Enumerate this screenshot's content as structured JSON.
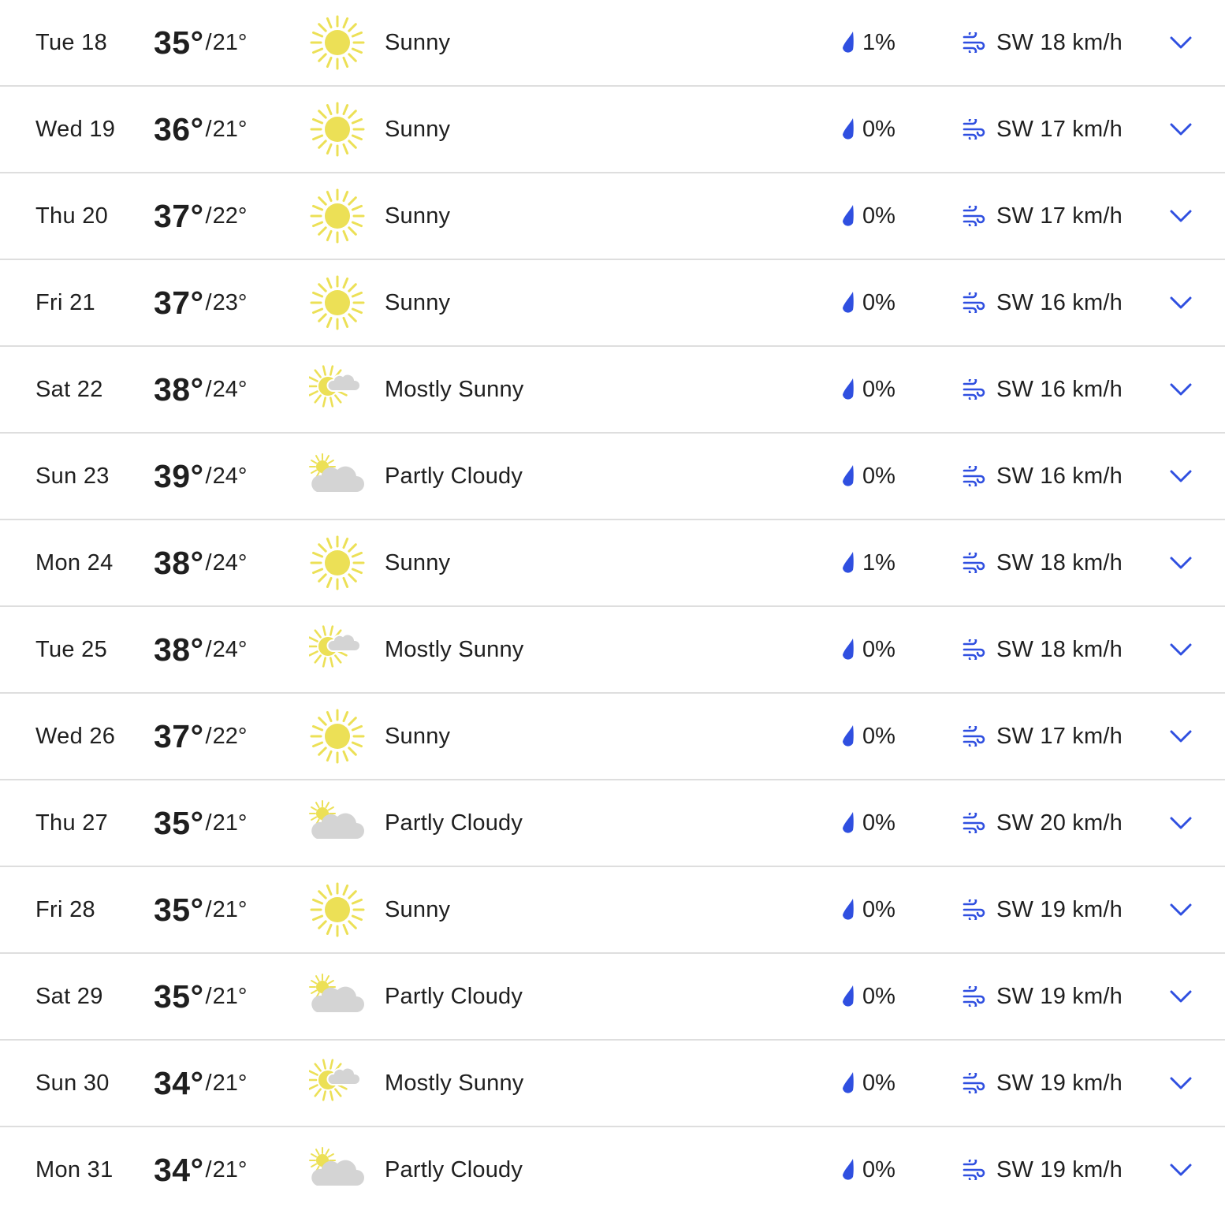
{
  "colors": {
    "text": "#1f1f1f",
    "accent": "#2f4fe0",
    "divider": "#dedede",
    "sun": "#ece056",
    "cloud": "#d4d4d4"
  },
  "forecast": [
    {
      "day": "Tue 18",
      "hi": "35°",
      "sep": "/",
      "lo": "21°",
      "icon": "sunny-icon",
      "condition": "Sunny",
      "precip": "1%",
      "wind": "SW 18 km/h"
    },
    {
      "day": "Wed 19",
      "hi": "36°",
      "sep": "/",
      "lo": "21°",
      "icon": "sunny-icon",
      "condition": "Sunny",
      "precip": "0%",
      "wind": "SW 17 km/h"
    },
    {
      "day": "Thu 20",
      "hi": "37°",
      "sep": "/",
      "lo": "22°",
      "icon": "sunny-icon",
      "condition": "Sunny",
      "precip": "0%",
      "wind": "SW 17 km/h"
    },
    {
      "day": "Fri 21",
      "hi": "37°",
      "sep": "/",
      "lo": "23°",
      "icon": "sunny-icon",
      "condition": "Sunny",
      "precip": "0%",
      "wind": "SW 16 km/h"
    },
    {
      "day": "Sat 22",
      "hi": "38°",
      "sep": "/",
      "lo": "24°",
      "icon": "mostly-sunny-icon",
      "condition": "Mostly Sunny",
      "precip": "0%",
      "wind": "SW 16 km/h"
    },
    {
      "day": "Sun 23",
      "hi": "39°",
      "sep": "/",
      "lo": "24°",
      "icon": "partly-cloudy-icon",
      "condition": "Partly Cloudy",
      "precip": "0%",
      "wind": "SW 16 km/h"
    },
    {
      "day": "Mon 24",
      "hi": "38°",
      "sep": "/",
      "lo": "24°",
      "icon": "sunny-icon",
      "condition": "Sunny",
      "precip": "1%",
      "wind": "SW 18 km/h"
    },
    {
      "day": "Tue 25",
      "hi": "38°",
      "sep": "/",
      "lo": "24°",
      "icon": "mostly-sunny-icon",
      "condition": "Mostly Sunny",
      "precip": "0%",
      "wind": "SW 18 km/h"
    },
    {
      "day": "Wed 26",
      "hi": "37°",
      "sep": "/",
      "lo": "22°",
      "icon": "sunny-icon",
      "condition": "Sunny",
      "precip": "0%",
      "wind": "SW 17 km/h"
    },
    {
      "day": "Thu 27",
      "hi": "35°",
      "sep": "/",
      "lo": "21°",
      "icon": "partly-cloudy-icon",
      "condition": "Partly Cloudy",
      "precip": "0%",
      "wind": "SW 20 km/h"
    },
    {
      "day": "Fri 28",
      "hi": "35°",
      "sep": "/",
      "lo": "21°",
      "icon": "sunny-icon",
      "condition": "Sunny",
      "precip": "0%",
      "wind": "SW 19 km/h"
    },
    {
      "day": "Sat 29",
      "hi": "35°",
      "sep": "/",
      "lo": "21°",
      "icon": "partly-cloudy-icon",
      "condition": "Partly Cloudy",
      "precip": "0%",
      "wind": "SW 19 km/h"
    },
    {
      "day": "Sun 30",
      "hi": "34°",
      "sep": "/",
      "lo": "21°",
      "icon": "mostly-sunny-icon",
      "condition": "Mostly Sunny",
      "precip": "0%",
      "wind": "SW 19 km/h"
    },
    {
      "day": "Mon 31",
      "hi": "34°",
      "sep": "/",
      "lo": "21°",
      "icon": "partly-cloudy-icon",
      "condition": "Partly Cloudy",
      "precip": "0%",
      "wind": "SW 19 km/h"
    }
  ]
}
